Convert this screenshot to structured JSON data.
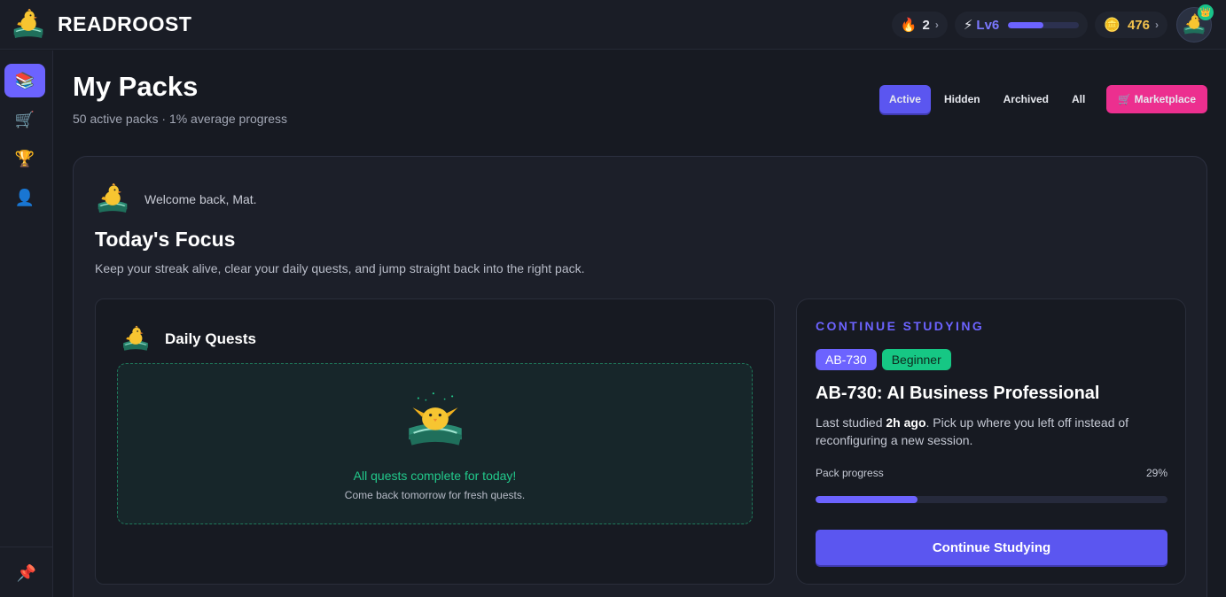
{
  "app": {
    "name": "READROOST",
    "logo_icon": "chick-on-book-icon"
  },
  "topbar": {
    "streak": {
      "icon": "fire-icon",
      "value": "2"
    },
    "level": {
      "icon": "lightning-icon",
      "label": "Lv6",
      "xp_fraction": 0.5
    },
    "coins": {
      "icon": "coin-icon",
      "value": "476"
    },
    "avatar_badge_icon": "crown-icon"
  },
  "sidebar": {
    "items": [
      {
        "name": "packs",
        "icon": "books-icon",
        "glyph": "📚",
        "active": true
      },
      {
        "name": "marketplace",
        "icon": "cart-icon",
        "glyph": "🛒",
        "active": false
      },
      {
        "name": "achievements",
        "icon": "trophy-icon",
        "glyph": "🏆",
        "active": false
      },
      {
        "name": "profile",
        "icon": "user-icon",
        "glyph": "👤",
        "active": false
      }
    ],
    "pin_icon": "pin-icon"
  },
  "header": {
    "title": "My Packs",
    "subtitle": "50 active packs · 1% average progress",
    "filters": [
      "Active",
      "Hidden",
      "Archived",
      "All"
    ],
    "active_filter": "Active",
    "marketplace_label": "🛒 Marketplace"
  },
  "focus": {
    "welcome": "Welcome back, Mat.",
    "title": "Today's Focus",
    "description": "Keep your streak alive, clear your daily quests, and jump straight back into the right pack."
  },
  "quests": {
    "title": "Daily Quests",
    "complete_message": "All quests complete for today!",
    "complete_sub": "Come back tomorrow for fresh quests."
  },
  "continue": {
    "label": "CONTINUE STUDYING",
    "code_tag": "AB-730",
    "level_tag": "Beginner",
    "title": "AB-730: AI Business Professional",
    "desc_prefix": "Last studied ",
    "desc_time": "2h ago",
    "desc_suffix": ". Pick up where you left off instead of reconfiguring a new session.",
    "progress_label": "Pack progress",
    "progress_text": "29%",
    "progress_value": 0.29,
    "button_label": "Continue Studying"
  },
  "colors": {
    "accent": "#6c63ff",
    "marketplace": "#ec2f8f",
    "success": "#22c98b",
    "coins": "#f3c24d"
  }
}
